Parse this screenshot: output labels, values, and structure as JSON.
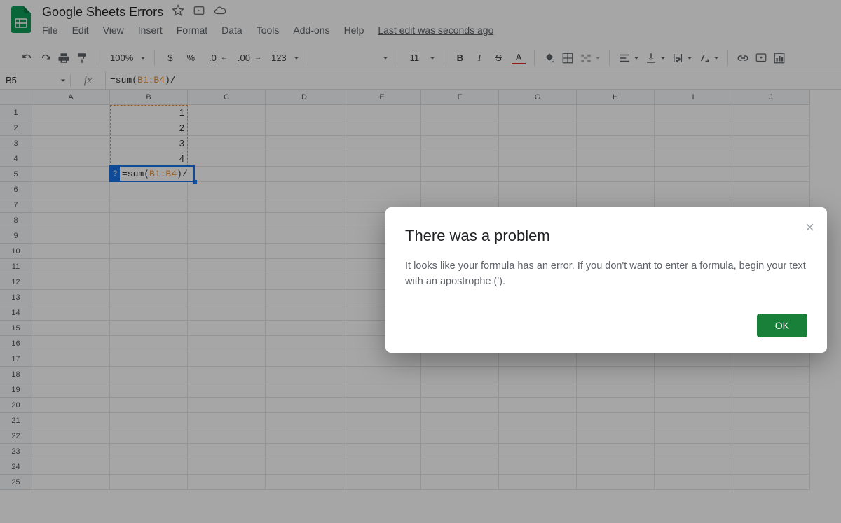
{
  "doc": {
    "title": "Google Sheets Errors",
    "last_edit": "Last edit was seconds ago"
  },
  "menu": {
    "file": "File",
    "edit": "Edit",
    "view": "View",
    "insert": "Insert",
    "format": "Format",
    "data": "Data",
    "tools": "Tools",
    "addons": "Add-ons",
    "help": "Help"
  },
  "toolbar": {
    "zoom": "100%",
    "currency": "$",
    "percent": "%",
    "dec_dec": ".0",
    "inc_dec": ".00",
    "number_fmt": "123",
    "font": "",
    "font_size": "11",
    "bold": "B",
    "italic": "I",
    "strike": "S",
    "text_color": "A"
  },
  "formula_bar": {
    "name_box": "B5",
    "fx": "fx",
    "formula_prefix": "=sum(",
    "formula_ref": "B1:B4",
    "formula_suffix": ")/"
  },
  "grid": {
    "columns": [
      "A",
      "B",
      "C",
      "D",
      "E",
      "F",
      "G",
      "H",
      "I",
      "J"
    ],
    "row_count": 25,
    "values": {
      "B1": "1",
      "B2": "2",
      "B3": "3",
      "B4": "4"
    },
    "active_cell": {
      "prefix": "=sum(",
      "ref": "B1:B4",
      "suffix": ")/",
      "hint": "?"
    }
  },
  "dialog": {
    "title": "There was a problem",
    "body": "It looks like your formula has an error. If you don't want to enter a formula, begin your text with an apostrophe (').",
    "ok": "OK"
  }
}
